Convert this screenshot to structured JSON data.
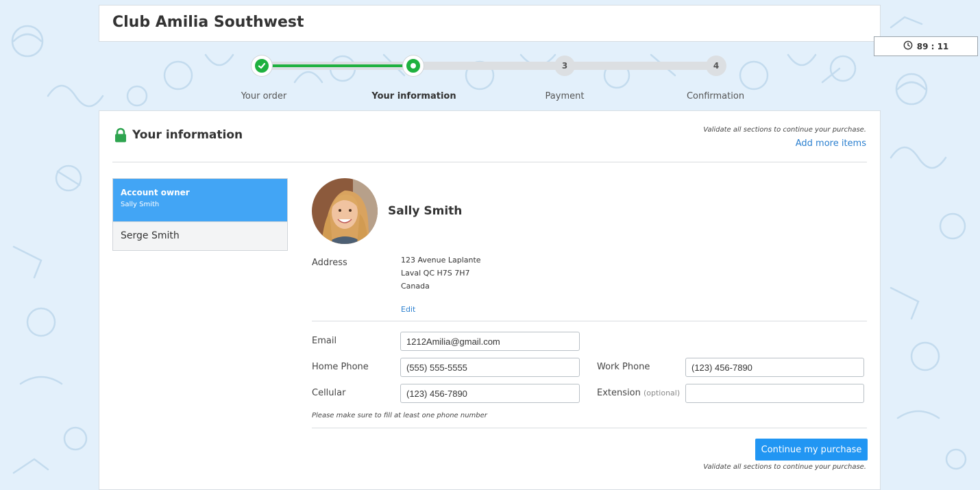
{
  "header": {
    "club_name": "Club Amilia Southwest"
  },
  "timer": {
    "value": "89 : 11"
  },
  "steps": [
    {
      "number": "1",
      "label": "Your order",
      "state": "done"
    },
    {
      "number": "2",
      "label": "Your information",
      "state": "current"
    },
    {
      "number": "3",
      "label": "Payment",
      "state": "upcoming"
    },
    {
      "number": "4",
      "label": "Confirmation",
      "state": "upcoming"
    }
  ],
  "section": {
    "title": "Your information",
    "validate_note": "Validate all sections to continue your purchase.",
    "add_more_items": "Add more items"
  },
  "members": [
    {
      "role": "Account owner",
      "name": "Sally Smith",
      "selected": true
    },
    {
      "name": "Serge Smith",
      "selected": false
    }
  ],
  "profile": {
    "name": "Sally Smith",
    "address_label": "Address",
    "address_lines": [
      "123 Avenue Laplante",
      "Laval QC H7S 7H7",
      "Canada"
    ],
    "edit_label": "Edit"
  },
  "form": {
    "email_label": "Email",
    "email_value": "1212Amilia@gmail.com",
    "home_phone_label": "Home Phone",
    "home_phone_value": "(555) 555-5555",
    "work_phone_label": "Work Phone",
    "work_phone_value": "(123) 456-7890",
    "cellular_label": "Cellular",
    "cellular_value": "(123) 456-7890",
    "extension_label": "Extension",
    "extension_optional": "(optional)",
    "extension_value": "",
    "phone_note": "Please make sure to fill at least one phone number"
  },
  "footer": {
    "continue_label": "Continue my purchase",
    "validate_note": "Validate all sections to continue your purchase."
  },
  "colors": {
    "accent_blue": "#2196f3",
    "progress_green": "#1fb13f",
    "selected_member": "#42a5f5",
    "lock_green": "#2ea44f"
  }
}
